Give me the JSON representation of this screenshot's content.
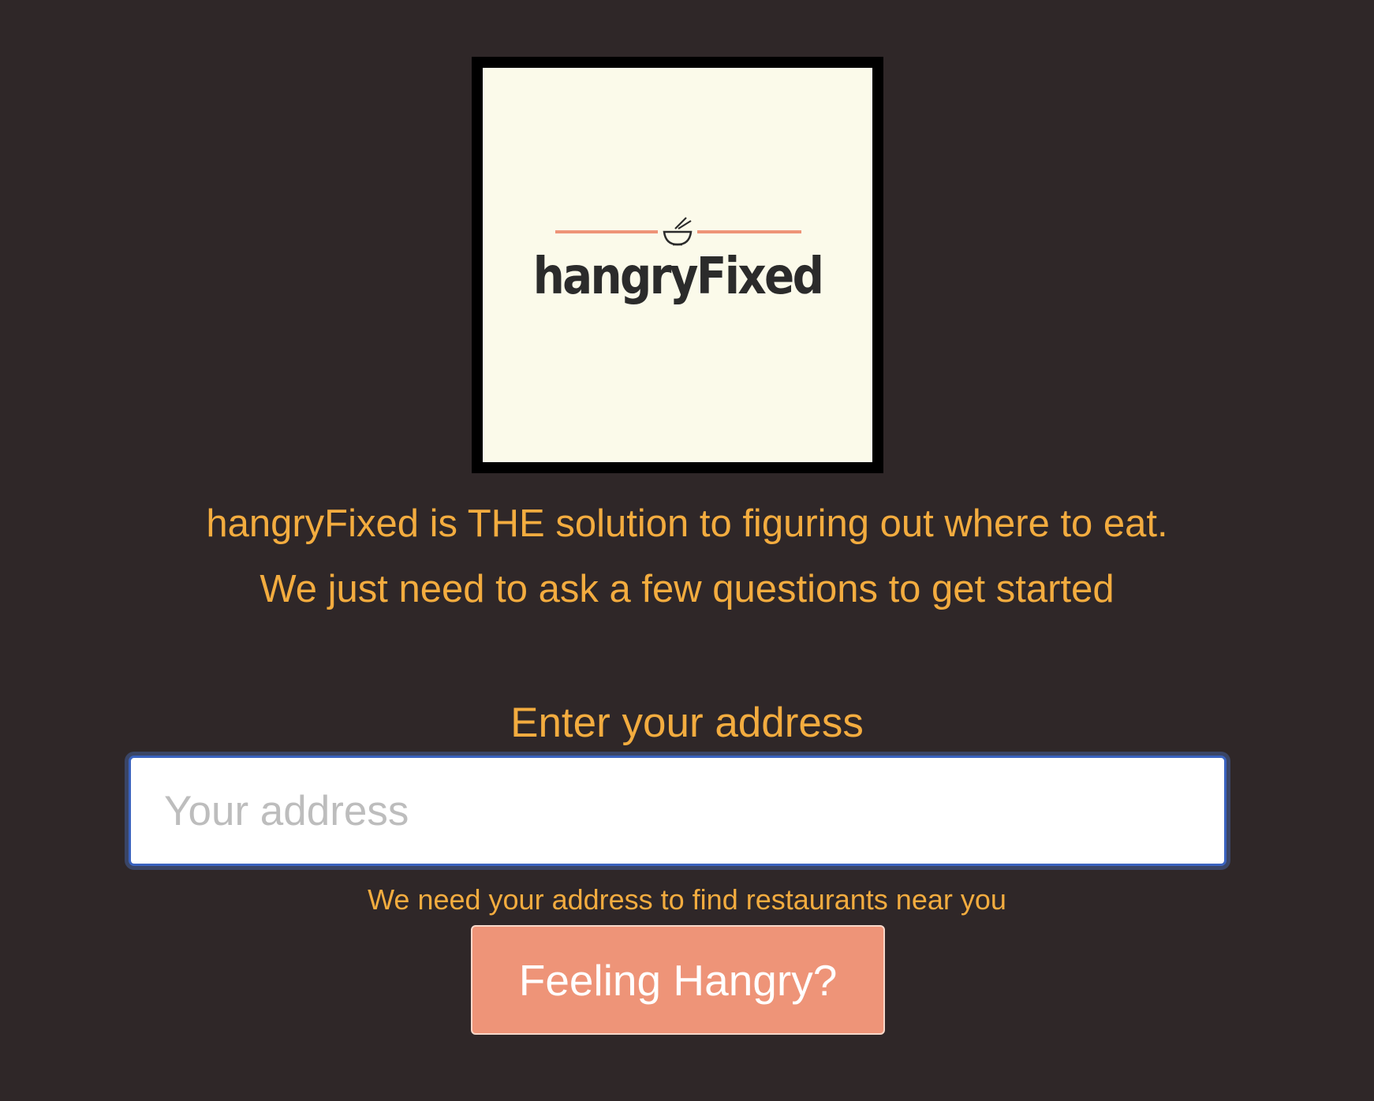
{
  "logo": {
    "wordmark": "hangryFixed",
    "icon": "bowl-with-chopsticks-icon",
    "line_color": "#ee9478"
  },
  "intro": {
    "line1": "hangryFixed is THE solution to figuring out where to eat.",
    "line2": "We just need to ask a few questions to get started"
  },
  "address": {
    "label": "Enter your address",
    "placeholder": "Your address",
    "value": "",
    "help_text": "We need your address to find restaurants near you"
  },
  "submit_button": {
    "label": "Feeling Hangry?"
  },
  "colors": {
    "background": "#2f2728",
    "accent_text": "#f3ac3f",
    "button": "#ee9478",
    "input_focus": "#3a63c0"
  }
}
